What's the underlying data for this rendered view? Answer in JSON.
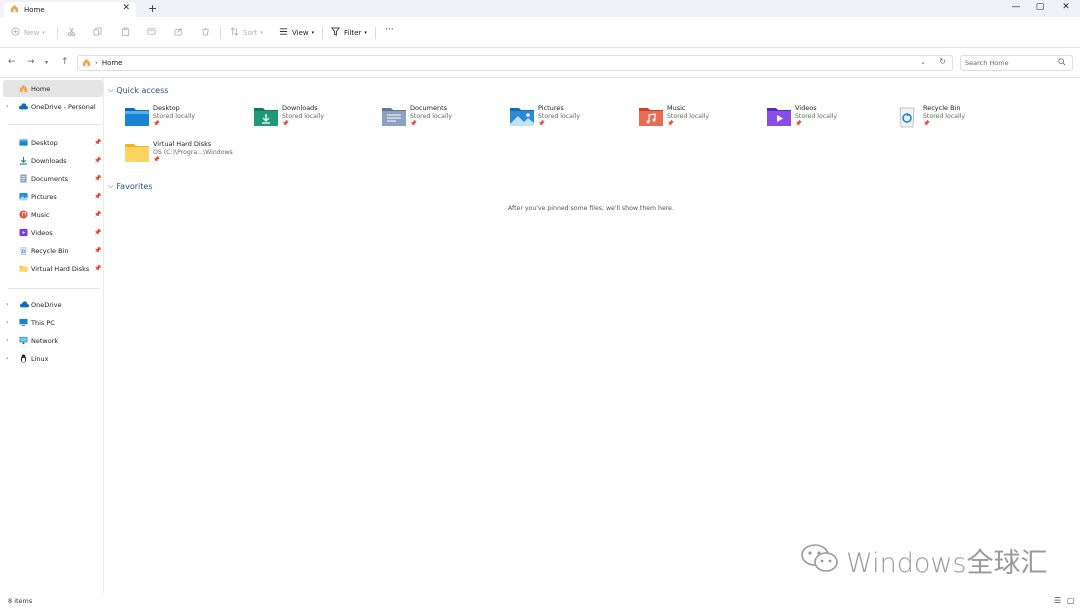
{
  "tabs": [
    {
      "label": "Home",
      "icon": "home-icon"
    }
  ],
  "new_tab_label": "+",
  "window_controls": {
    "minimize": "—",
    "maximize": "▢",
    "close": "✕"
  },
  "toolbar": {
    "new_label": "New",
    "sort_label": "Sort",
    "view_label": "View",
    "filter_label": "Filter",
    "more_label": "···"
  },
  "address": {
    "path": [
      "Home"
    ]
  },
  "search": {
    "placeholder": "Search Home"
  },
  "sidebar": {
    "top": [
      {
        "label": "Home",
        "icon": "home-icon",
        "selected": true
      },
      {
        "label": "OneDrive - Personal",
        "icon": "cloud-icon",
        "expandable": true
      }
    ],
    "pinned": [
      {
        "label": "Desktop",
        "icon": "desktop-folder-icon"
      },
      {
        "label": "Downloads",
        "icon": "download-icon"
      },
      {
        "label": "Documents",
        "icon": "documents-icon"
      },
      {
        "label": "Pictures",
        "icon": "pictures-icon"
      },
      {
        "label": "Music",
        "icon": "music-icon"
      },
      {
        "label": "Videos",
        "icon": "videos-icon"
      },
      {
        "label": "Recycle Bin",
        "icon": "recycle-bin-icon"
      },
      {
        "label": "Virtual Hard Disks",
        "icon": "folder-icon"
      }
    ],
    "bottom": [
      {
        "label": "OneDrive",
        "icon": "cloud-icon"
      },
      {
        "label": "This PC",
        "icon": "pc-icon"
      },
      {
        "label": "Network",
        "icon": "network-icon"
      },
      {
        "label": "Linux",
        "icon": "linux-penguin-icon"
      }
    ]
  },
  "quick_access": {
    "title": "Quick access",
    "items": [
      {
        "name": "Desktop",
        "sub": "Stored locally",
        "icon": "desktop-folder-icon"
      },
      {
        "name": "Downloads",
        "sub": "Stored locally",
        "icon": "downloads-folder-icon"
      },
      {
        "name": "Documents",
        "sub": "Stored locally",
        "icon": "documents-folder-icon"
      },
      {
        "name": "Pictures",
        "sub": "Stored locally",
        "icon": "pictures-folder-icon"
      },
      {
        "name": "Music",
        "sub": "Stored locally",
        "icon": "music-folder-icon"
      },
      {
        "name": "Videos",
        "sub": "Stored locally",
        "icon": "videos-folder-icon"
      },
      {
        "name": "Recycle Bin",
        "sub": "Stored locally",
        "icon": "recycle-bin-icon"
      },
      {
        "name": "Virtual Hard Disks",
        "sub": "OS (C:)\\Progra...\\Windows",
        "icon": "folder-icon"
      }
    ]
  },
  "favorites": {
    "title": "Favorites",
    "empty_message": "After you've pinned some files, we'll show them here."
  },
  "status": {
    "item_count": "8 items"
  },
  "watermark": {
    "text": "Windows全球汇"
  }
}
